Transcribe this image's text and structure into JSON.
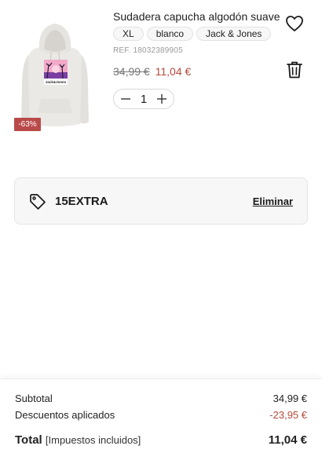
{
  "product": {
    "image_label": "Jack&Jones",
    "discount_badge": "-63%",
    "title": "Sudadera capucha algodón suave",
    "chips": [
      "XL",
      "blanco",
      "Jack & Jones"
    ],
    "ref": "REF. 18032389905",
    "price_old": "34,99 €",
    "price_new": "11,04 €",
    "quantity": "1",
    "favorite_icon": "heart-outline-icon",
    "delete_icon": "trash-icon"
  },
  "coupon": {
    "icon": "tag-icon",
    "code": "15EXTRA",
    "remove_label": "Eliminar"
  },
  "summary": {
    "subtotal_label": "Subtotal",
    "subtotal_value": "34,99 €",
    "discount_label": "Descuentos aplicados",
    "discount_value": "-23,95 €",
    "total_label": "Total",
    "total_note": "[Impuestos incluidos]",
    "total_value": "11,04 €"
  },
  "colors": {
    "accent_red": "#b54a3c",
    "badge_red": "#b94a4a"
  }
}
